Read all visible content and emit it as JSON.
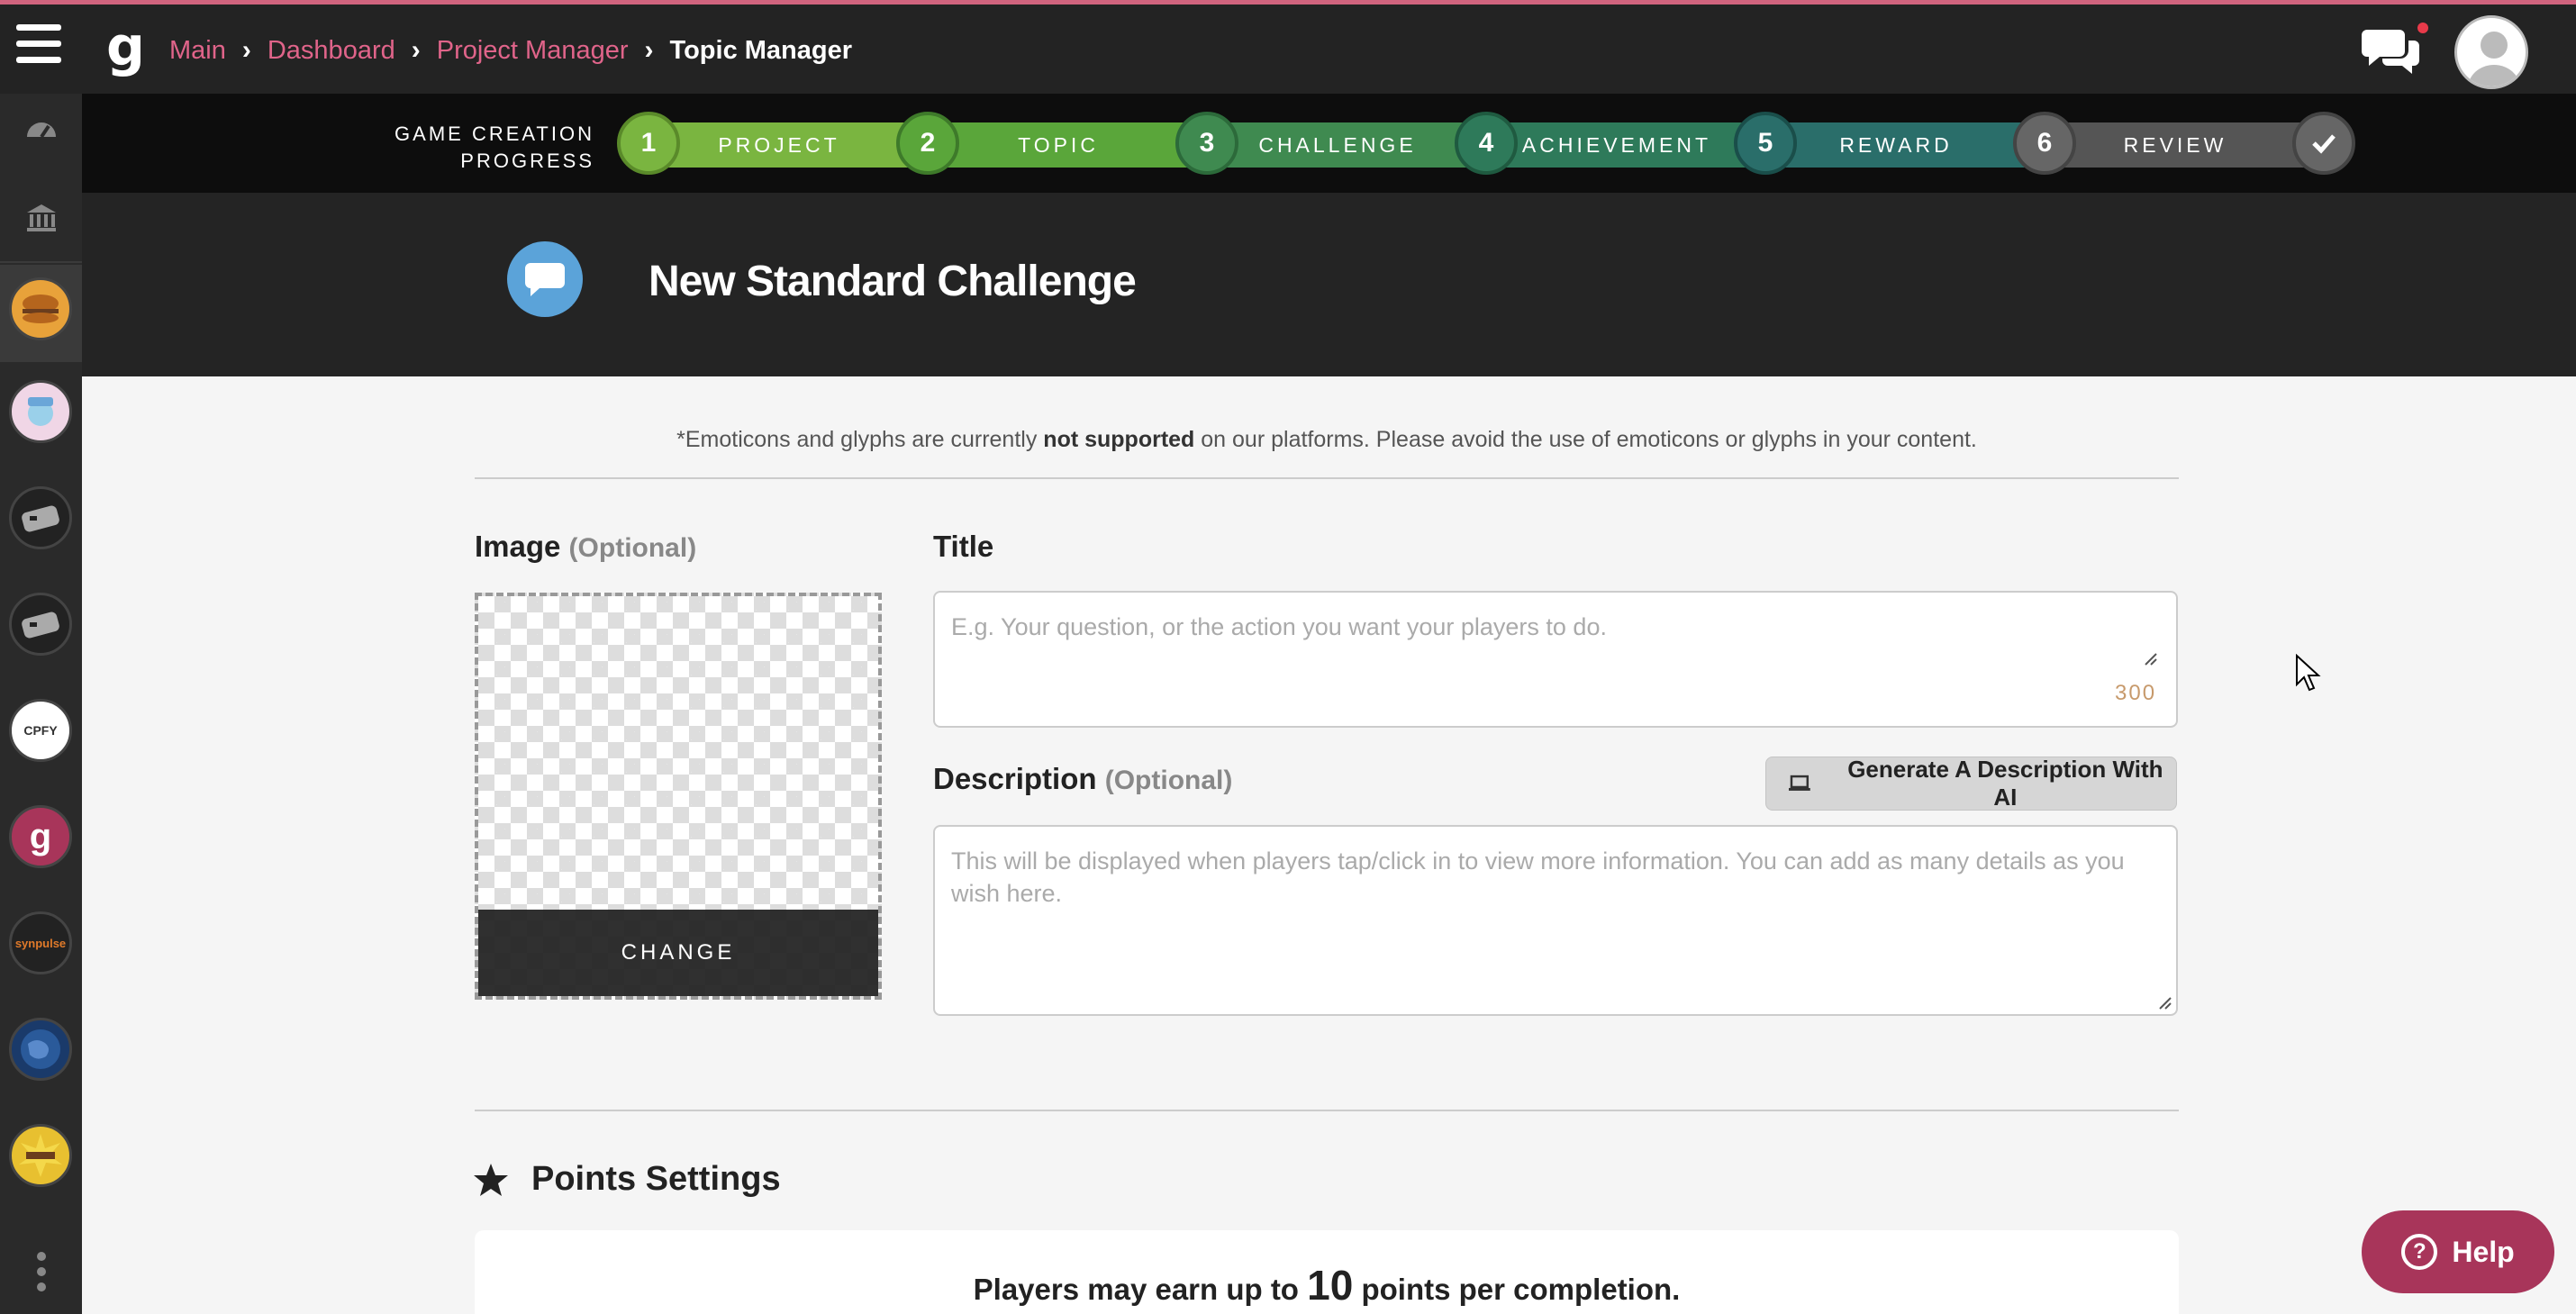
{
  "breadcrumb": {
    "items": [
      "Main",
      "Dashboard",
      "Project Manager"
    ],
    "current": "Topic Manager"
  },
  "progress": {
    "label_line1": "GAME CREATION",
    "label_line2": "PROGRESS",
    "steps": [
      {
        "number": "1",
        "label": "PROJECT"
      },
      {
        "number": "2",
        "label": "TOPIC"
      },
      {
        "number": "3",
        "label": "CHALLENGE"
      },
      {
        "number": "4",
        "label": "ACHIEVEMENT"
      },
      {
        "number": "5",
        "label": "REWARD"
      },
      {
        "number": "6",
        "label": "REVIEW"
      }
    ]
  },
  "header": {
    "title": "New Standard Challenge"
  },
  "notice": {
    "prefix": "*Emoticons and glyphs are currently ",
    "bold": "not supported",
    "suffix": " on our platforms. Please avoid the use of emoticons or glyphs in your content."
  },
  "image_field": {
    "label": "Image",
    "optional": "(Optional)",
    "change_label": "CHANGE"
  },
  "title_field": {
    "label": "Title",
    "placeholder": "E.g. Your question, or the action you want your players to do.",
    "counter": "300"
  },
  "description_field": {
    "label": "Description",
    "optional": "(Optional)",
    "placeholder": "This will be displayed when players tap/click in to view more information. You can add as many details as you wish here.",
    "ai_button": "Generate A Description With AI"
  },
  "points": {
    "title": "Points Settings",
    "text_prefix": "Players may earn up to ",
    "value": "10",
    "text_suffix": " points per completion."
  },
  "sidebar": {
    "items": [
      "dashboard-icon",
      "bank-icon",
      "project-avatar-burger",
      "project-avatar-nurse",
      "project-avatar-robot-1",
      "project-avatar-robot-2",
      "project-avatar-cpfy",
      "project-avatar-g",
      "project-avatar-synpulse",
      "project-avatar-globe",
      "project-avatar-explosion"
    ],
    "cpfy_text": "CPFY",
    "synpulse_text": "synpulse",
    "g_text": "g"
  },
  "help": {
    "label": "Help"
  },
  "colors": {
    "accent_pink": "#e0648a",
    "step_light_green": "#7ab540",
    "step_mid_green": "#3f8a50",
    "step_teal": "#2a6e6a",
    "step_grey": "#555555",
    "help_bg": "#a8355a",
    "bubble_blue": "#5ba3d9"
  }
}
